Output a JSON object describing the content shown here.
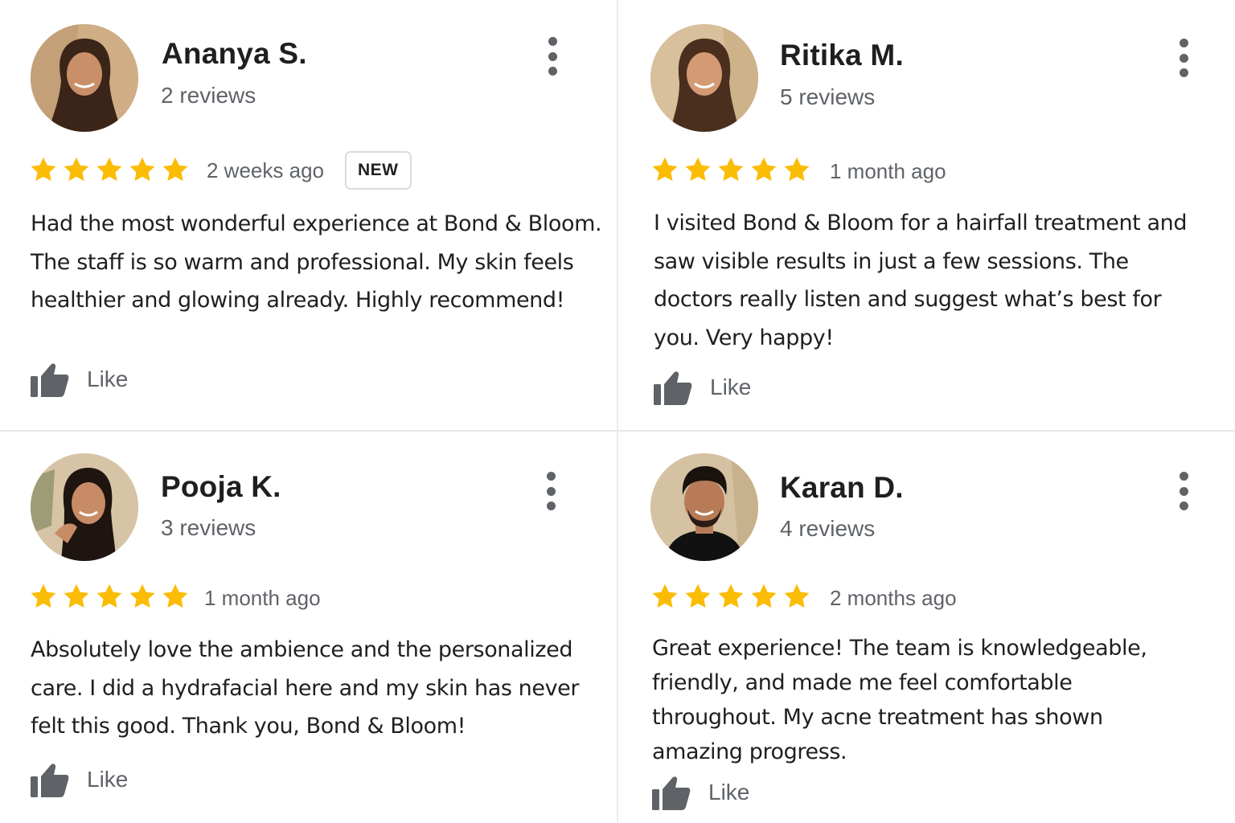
{
  "colors": {
    "star": "#fbbc04",
    "secondary_text": "#5f6368",
    "divider": "#e8e8e8"
  },
  "reviews": [
    {
      "name": "Ananya S.",
      "review_count": "2 reviews",
      "rating": 5,
      "date": "2 weeks ago",
      "badge": "NEW",
      "text": [
        "Had the most wonderful experience at Bond & Bloom.",
        "The staff is so warm and professional. My skin feels",
        "healthier and glowing already. Highly recommend!"
      ],
      "like_label": "Like",
      "avatar": "woman-avatar",
      "menu_icon": "more-vert-icon"
    },
    {
      "name": "Ritika M.",
      "review_count": "5 reviews",
      "rating": 5,
      "date": "1 month ago",
      "text": [
        "I visited Bond & Bloom for a hairfall treatment and",
        "saw visible results in just a few sessions. The",
        "doctors really listen and suggest what’s best for",
        "you. Very happy!"
      ],
      "like_label": "Like",
      "avatar": "woman-avatar",
      "menu_icon": "more-vert-icon"
    },
    {
      "name": "Pooja K.",
      "review_count": "3 reviews",
      "rating": 5,
      "date": "1 month ago",
      "text": [
        "Absolutely love the ambience and the personalized",
        "care. I did a hydrafacial here and my skin has never",
        "felt this good. Thank you, Bond & Bloom!"
      ],
      "like_label": "Like",
      "avatar": "woman-avatar",
      "menu_icon": "more-vert-icon"
    },
    {
      "name": "Karan D.",
      "review_count": "4 reviews",
      "rating": 5,
      "date": "2 months ago",
      "text": [
        "Great experience! The team is knowledgeable,",
        "friendly, and made me feel comfortable",
        "throughout. My acne treatment has shown",
        "amazing progress."
      ],
      "like_label": "Like",
      "avatar": "man-avatar",
      "menu_icon": "more-vert-icon"
    }
  ]
}
